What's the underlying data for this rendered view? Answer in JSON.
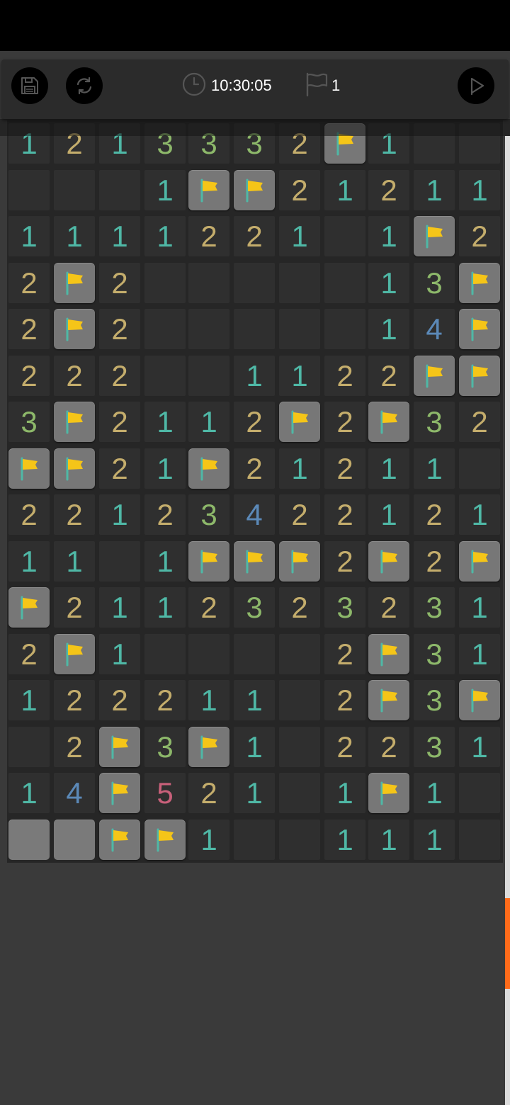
{
  "toolbar": {
    "save_icon": "floppy-disk-icon",
    "restart_icon": "refresh-icon",
    "timer_icon": "clock-icon",
    "timer": "10:30:05",
    "flag_icon": "flag-outline-icon",
    "flag_count": "1",
    "play_icon": "play-icon"
  },
  "colors": {
    "toolbar_bg": "#2b2b2b",
    "board_bg": "#262626",
    "cell_open": "#2f2f2f",
    "cell_flagged": "#777777",
    "flag": "#f5c518",
    "flag_pole": "#4fb8a6",
    "number_1": "#4fb8a6",
    "number_2": "#c4ad6c",
    "number_3": "#8db86a",
    "number_4": "#5b89b8",
    "number_5": "#c8607a",
    "scroll_thumb": "#ff6b1a"
  },
  "board": {
    "columns": 11,
    "legend": "F = flagged, C = covered, 0 = opened empty, 1-8 = number",
    "rows": [
      [
        "1",
        "2",
        "1",
        "3",
        "3",
        "3",
        "2",
        "F",
        "1",
        "0",
        "0"
      ],
      [
        "0",
        "0",
        "0",
        "1",
        "F",
        "F",
        "2",
        "1",
        "2",
        "1",
        "1"
      ],
      [
        "1",
        "1",
        "1",
        "1",
        "2",
        "2",
        "1",
        "0",
        "1",
        "F",
        "2"
      ],
      [
        "2",
        "F",
        "2",
        "0",
        "0",
        "0",
        "0",
        "0",
        "1",
        "3",
        "F"
      ],
      [
        "2",
        "F",
        "2",
        "0",
        "0",
        "0",
        "0",
        "0",
        "1",
        "4",
        "F"
      ],
      [
        "2",
        "2",
        "2",
        "0",
        "0",
        "1",
        "1",
        "2",
        "2",
        "F",
        "F"
      ],
      [
        "3",
        "F",
        "2",
        "1",
        "1",
        "2",
        "F",
        "2",
        "F",
        "3",
        "2"
      ],
      [
        "F",
        "F",
        "2",
        "1",
        "F",
        "2",
        "1",
        "2",
        "1",
        "1",
        "0"
      ],
      [
        "2",
        "2",
        "1",
        "2",
        "3",
        "4",
        "2",
        "2",
        "1",
        "2",
        "1"
      ],
      [
        "1",
        "1",
        "0",
        "1",
        "F",
        "F",
        "F",
        "2",
        "F",
        "2",
        "F"
      ],
      [
        "F",
        "2",
        "1",
        "1",
        "2",
        "3",
        "2",
        "3",
        "2",
        "3",
        "1"
      ],
      [
        "2",
        "F",
        "1",
        "0",
        "0",
        "0",
        "0",
        "2",
        "F",
        "3",
        "1"
      ],
      [
        "1",
        "2",
        "2",
        "2",
        "1",
        "1",
        "0",
        "2",
        "F",
        "3",
        "F"
      ],
      [
        "0",
        "2",
        "F",
        "3",
        "F",
        "1",
        "0",
        "2",
        "2",
        "3",
        "1"
      ],
      [
        "1",
        "4",
        "F",
        "5",
        "2",
        "1",
        "0",
        "1",
        "F",
        "1",
        "0"
      ],
      [
        "C",
        "C",
        "F",
        "F",
        "1",
        "0",
        "0",
        "1",
        "1",
        "1",
        "0"
      ]
    ]
  }
}
